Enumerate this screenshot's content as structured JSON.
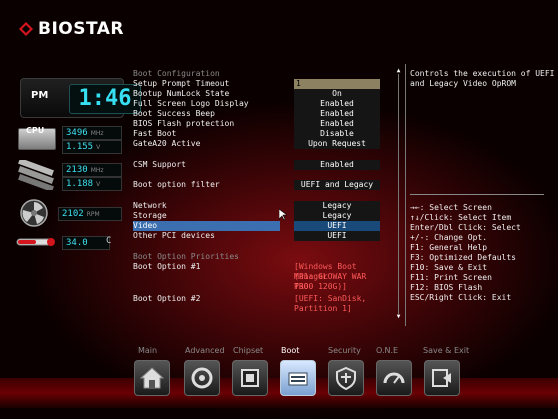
{
  "brand": {
    "name": "BIOSTAR"
  },
  "status": {
    "clock_meridiem": "PM",
    "clock_time": "1:46",
    "cpu_label": "CPU",
    "cpu_freq": "3496",
    "cpu_freq_unit": "MHz",
    "cpu_voltage": "1.155",
    "cpu_voltage_unit": "V",
    "mem_freq": "2130",
    "mem_freq_unit": "MHz",
    "mem_voltage": "1.188",
    "mem_voltage_unit": "V",
    "fan_speed": "2102",
    "fan_unit": "RPM",
    "temperature": "34.0",
    "temperature_unit": "C"
  },
  "settings": {
    "boot_configuration_title": "Boot Configuration",
    "setup_prompt_timeout": {
      "label": "Setup Prompt Timeout",
      "value": "1"
    },
    "bootup_numlock_state": {
      "label": "Bootup NumLock State",
      "value": "On"
    },
    "full_screen_logo": {
      "label": "Full Screen Logo Display",
      "value": "Enabled"
    },
    "boot_success_beep": {
      "label": "Boot Success Beep",
      "value": "Enabled"
    },
    "bios_flash_protection": {
      "label": "BIOS Flash protection",
      "value": "Enabled"
    },
    "fast_boot": {
      "label": "Fast Boot",
      "value": "Disable"
    },
    "gatea20_active": {
      "label": "GateA20 Active",
      "value": "Upon Request"
    },
    "csm_support": {
      "label": "CSM Support",
      "value": "Enabled"
    },
    "boot_option_filter": {
      "label": "Boot option filter",
      "value": "UEFI and Legacy"
    },
    "network": {
      "label": "Network",
      "value": "Legacy"
    },
    "storage": {
      "label": "Storage",
      "value": "Legacy"
    },
    "video": {
      "label": "Video",
      "value": "UEFI"
    },
    "other_pci": {
      "label": "Other PCI devices",
      "value": "UEFI"
    },
    "boot_option_priorities_title": "Boot Option Priorities",
    "boot_option_1": {
      "label": "Boot Option #1",
      "value_lines": [
        "[Windows Boot Manager",
        "(P1: GLOWAY WAR PRO",
        "T300 120G)]"
      ]
    },
    "boot_option_2": {
      "label": "Boot Option #2",
      "value_lines": [
        "[UEFI: SanDisk,",
        "Partition 1]"
      ]
    }
  },
  "help": {
    "description_lines": [
      "Controls the execution of UEFI",
      "and Legacy Video OpROM"
    ],
    "keys": [
      "→←: Select Screen",
      "↑↓/Click: Select Item",
      "Enter/Dbl Click: Select",
      "+/-: Change Opt.",
      "F1: General Help",
      "F3: Optimized Defaults",
      "F10: Save & Exit",
      "F11: Print Screen",
      "F12: BIOS Flash",
      "ESC/Right Click: Exit"
    ]
  },
  "nav": {
    "tabs": [
      "Main",
      "Advanced",
      "Chipset",
      "Boot",
      "Security",
      "O.N.E",
      "Save & Exit"
    ],
    "active": "Boot",
    "icons": [
      "home-icon",
      "advanced-icon",
      "chipset-icon",
      "boot-icon",
      "security-icon",
      "one-icon",
      "save-exit-icon"
    ]
  },
  "colors": {
    "accent_red": "#c0141c",
    "value_cyan": "#36e0f2",
    "selection_blue": "#3b6fb0"
  }
}
